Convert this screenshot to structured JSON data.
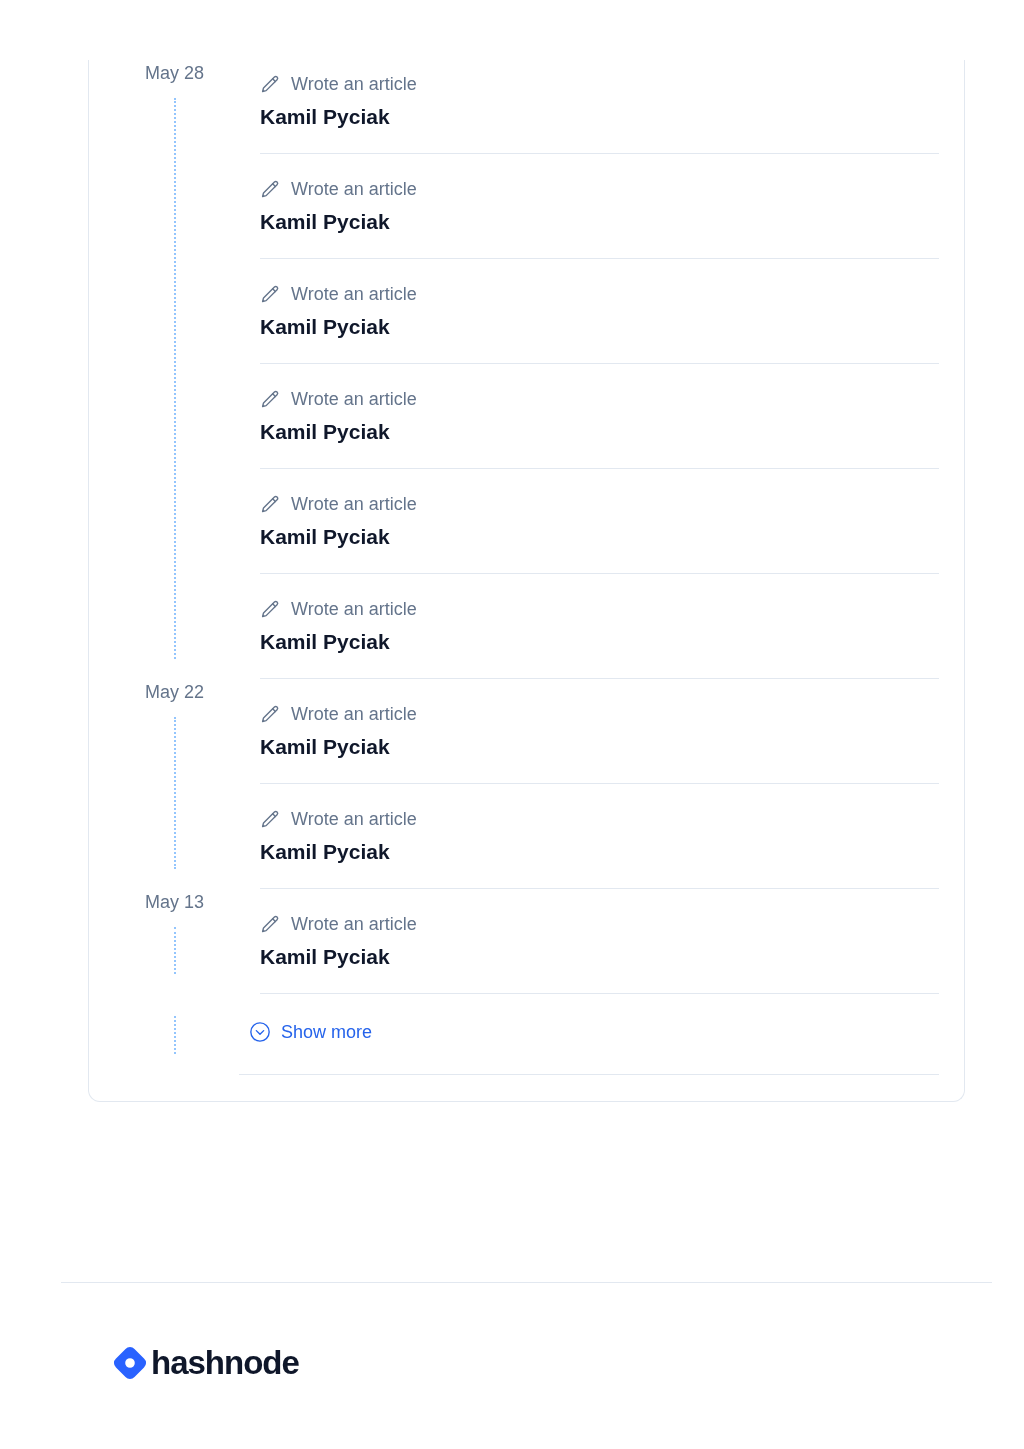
{
  "activity": {
    "groups": [
      {
        "date": "May 28",
        "items": [
          {
            "action": "Wrote an article",
            "title": "Kamil Pyciak"
          },
          {
            "action": "Wrote an article",
            "title": "Kamil Pyciak"
          },
          {
            "action": "Wrote an article",
            "title": "Kamil Pyciak"
          },
          {
            "action": "Wrote an article",
            "title": "Kamil Pyciak"
          },
          {
            "action": "Wrote an article",
            "title": "Kamil Pyciak"
          },
          {
            "action": "Wrote an article",
            "title": "Kamil Pyciak"
          }
        ]
      },
      {
        "date": "May 22",
        "items": [
          {
            "action": "Wrote an article",
            "title": "Kamil Pyciak"
          },
          {
            "action": "Wrote an article",
            "title": "Kamil Pyciak"
          }
        ]
      },
      {
        "date": "May 13",
        "items": [
          {
            "action": "Wrote an article",
            "title": "Kamil Pyciak"
          }
        ]
      }
    ],
    "show_more": {
      "label": "Show more"
    }
  },
  "footer": {
    "logo_text": "hashnode"
  }
}
